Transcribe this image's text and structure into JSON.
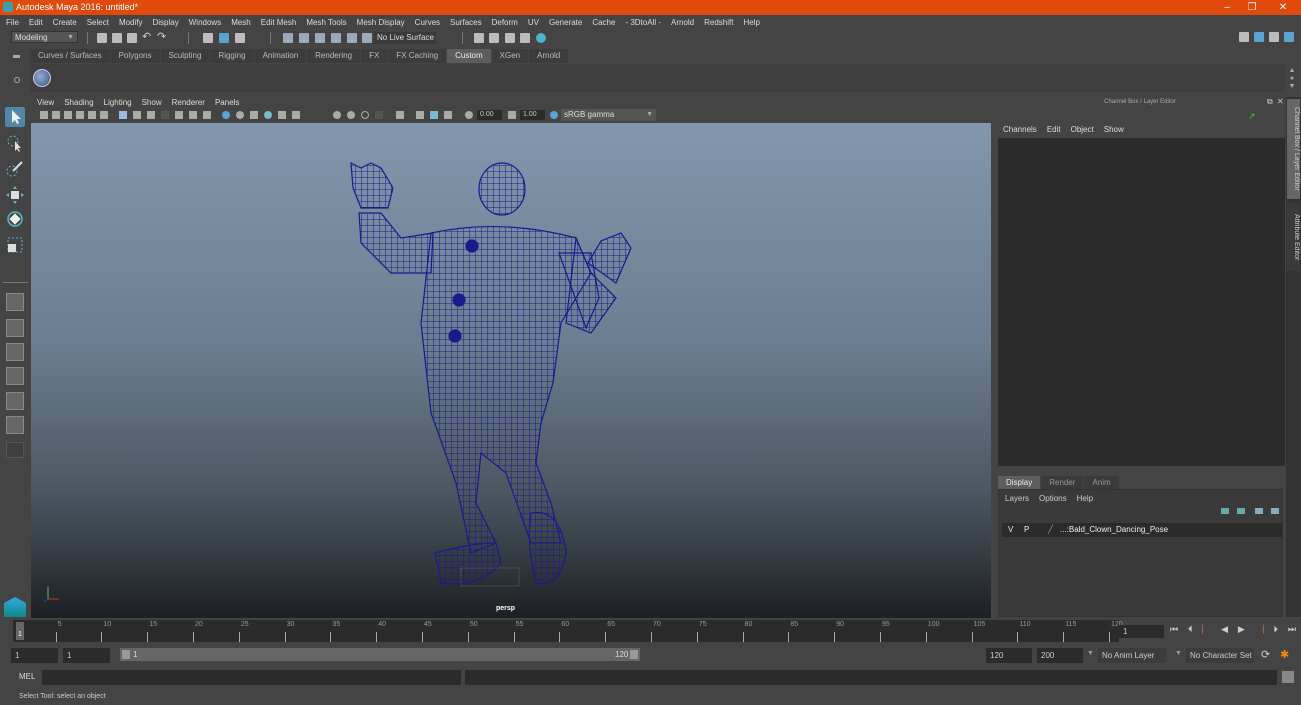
{
  "window": {
    "title": "Autodesk Maya 2016: untitled*",
    "controls": [
      "minimize",
      "restore",
      "close"
    ]
  },
  "menubar": [
    "File",
    "Edit",
    "Create",
    "Select",
    "Modify",
    "Display",
    "Windows",
    "Mesh",
    "Edit Mesh",
    "Mesh Tools",
    "Mesh Display",
    "Curves",
    "Surfaces",
    "Deform",
    "UV",
    "Generate",
    "Cache",
    "- 3DtoAll -",
    "Arnold",
    "Redshift",
    "Help"
  ],
  "toolbar": {
    "menuset": "Modeling",
    "live_surface": "No Live Surface"
  },
  "shelf": {
    "tabs": [
      "Curves / Surfaces",
      "Polygons",
      "Sculpting",
      "Rigging",
      "Animation",
      "Rendering",
      "FX",
      "FX Caching",
      "Custom",
      "XGen",
      "Arnold"
    ],
    "active_tab": "Custom"
  },
  "viewport": {
    "menu": [
      "View",
      "Shading",
      "Lighting",
      "Show",
      "Renderer",
      "Panels"
    ],
    "exposure": "0.00",
    "gamma": "1.00",
    "color_space": "sRGB gamma",
    "camera_label": "persp",
    "axis": {
      "x": "x",
      "y": "y"
    },
    "wire_color": "#1a1a8c"
  },
  "channel_box": {
    "title": "Channel Box / Layer Editor",
    "menu": [
      "Channels",
      "Edit",
      "Object",
      "Show"
    ]
  },
  "layer_editor": {
    "tabs": [
      "Display",
      "Render",
      "Anim"
    ],
    "active_tab": "Display",
    "menu": [
      "Layers",
      "Options",
      "Help"
    ],
    "layers": [
      {
        "v": "V",
        "p": "P",
        "name": "...:Bald_Clown_Dancing_Pose"
      }
    ]
  },
  "side_tabs": [
    "Channel Box / Layer Editor",
    "Attribute Editor"
  ],
  "timeline": {
    "ticks": [
      "5",
      "10",
      "15",
      "20",
      "25",
      "30",
      "35",
      "40",
      "45",
      "50",
      "55",
      "60",
      "65",
      "70",
      "75",
      "80",
      "85",
      "90",
      "95",
      "100",
      "105",
      "110",
      "115",
      "120"
    ],
    "start_label": "1",
    "current_frame": "1"
  },
  "range": {
    "start": "1",
    "playback_start": "1",
    "slider_start": "1",
    "slider_end": "120",
    "playback_end": "120",
    "end": "200",
    "anim_layer": "No Anim Layer",
    "character_set": "No Character Set"
  },
  "command_line": {
    "lang": "MEL"
  },
  "status": "Select Tool: select an object"
}
